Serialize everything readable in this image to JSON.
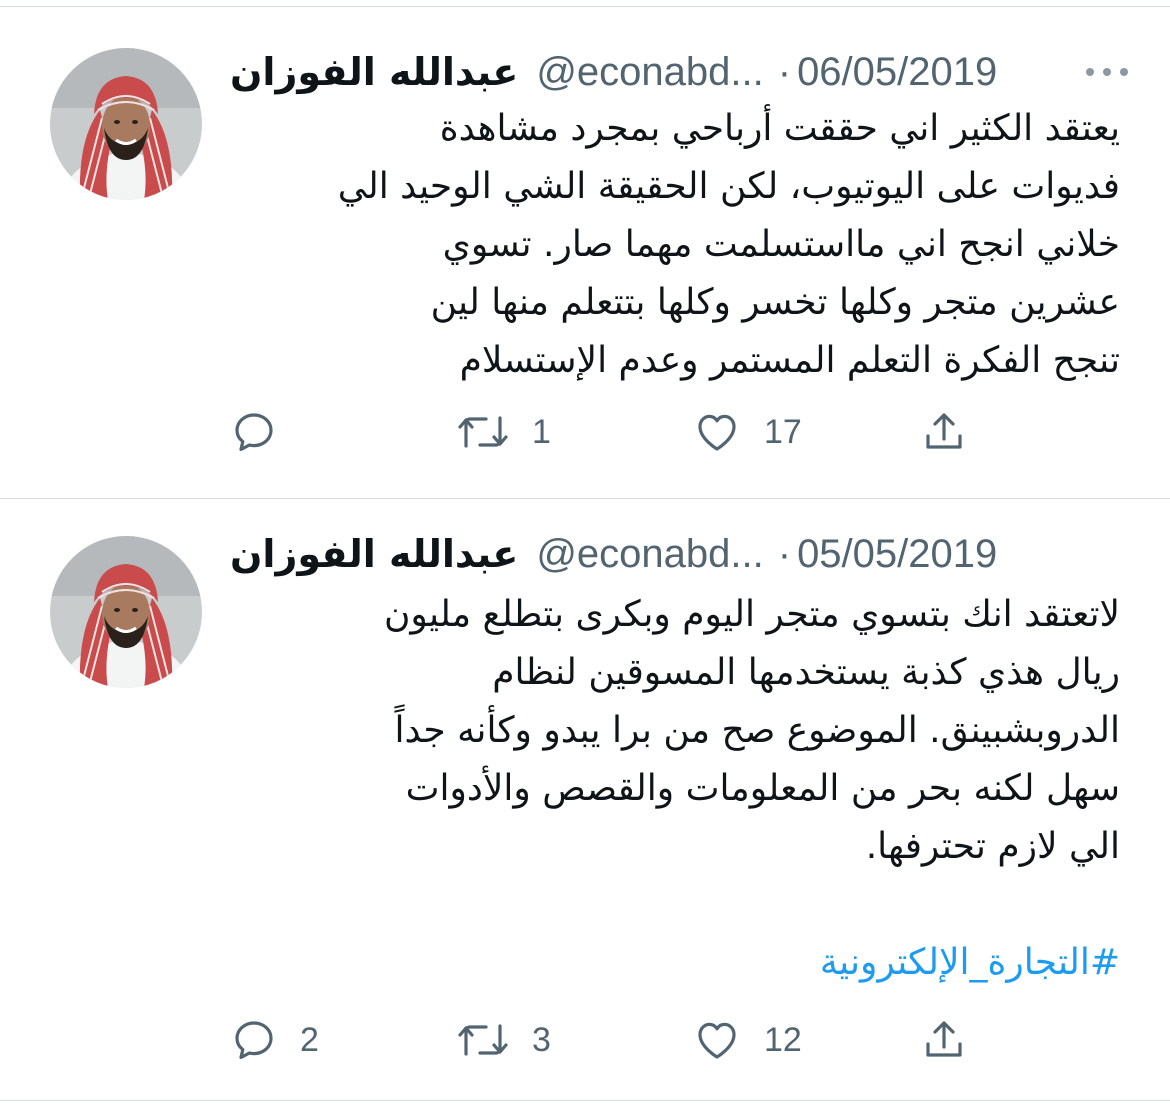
{
  "colors": {
    "text": "#0f1419",
    "secondary": "#536471",
    "hashtag": "#1d9bf0",
    "divider": "#d9dde1"
  },
  "tweets": [
    {
      "author_name": "عبدالله الفوزان",
      "handle": "@econabd...",
      "separator": "·",
      "date": "06/05/2019",
      "text": "يعتقد الكثير اني حققت أرباحي بمجرد مشاهدة\nفديوات على اليوتيوب، لكن الحقيقة الشي الوحيد الي\nخلاني انجح اني مااستسلمت مهما صار. تسوي\nعشرين متجر وكلها تخسر وكلها بتتعلم منها لين\nتنجح الفكرة التعلم المستمر وعدم الإستسلام",
      "hashtag": "",
      "replies": "",
      "retweets": "1",
      "likes": "17",
      "icons": [
        "reply-icon",
        "retweet-icon",
        "like-icon",
        "share-icon",
        "more-icon"
      ]
    },
    {
      "author_name": "عبدالله الفوزان",
      "handle": "@econabd...",
      "separator": "·",
      "date": "05/05/2019",
      "text": "لاتعتقد انك بتسوي متجر اليوم وبكرى بتطلع مليون\nريال هذي كذبة يستخدمها المسوقين لنظام\nالدروبشبينق. الموضوع صح من برا يبدو وكأنه جداً\nسهل لكنه بحر من المعلومات والقصص والأدوات\nالي لازم تحترفها.",
      "hashtag": "#التجارة_الإلكترونية",
      "replies": "2",
      "retweets": "3",
      "likes": "12",
      "icons": [
        "reply-icon",
        "retweet-icon",
        "like-icon",
        "share-icon",
        "more-icon"
      ]
    }
  ]
}
